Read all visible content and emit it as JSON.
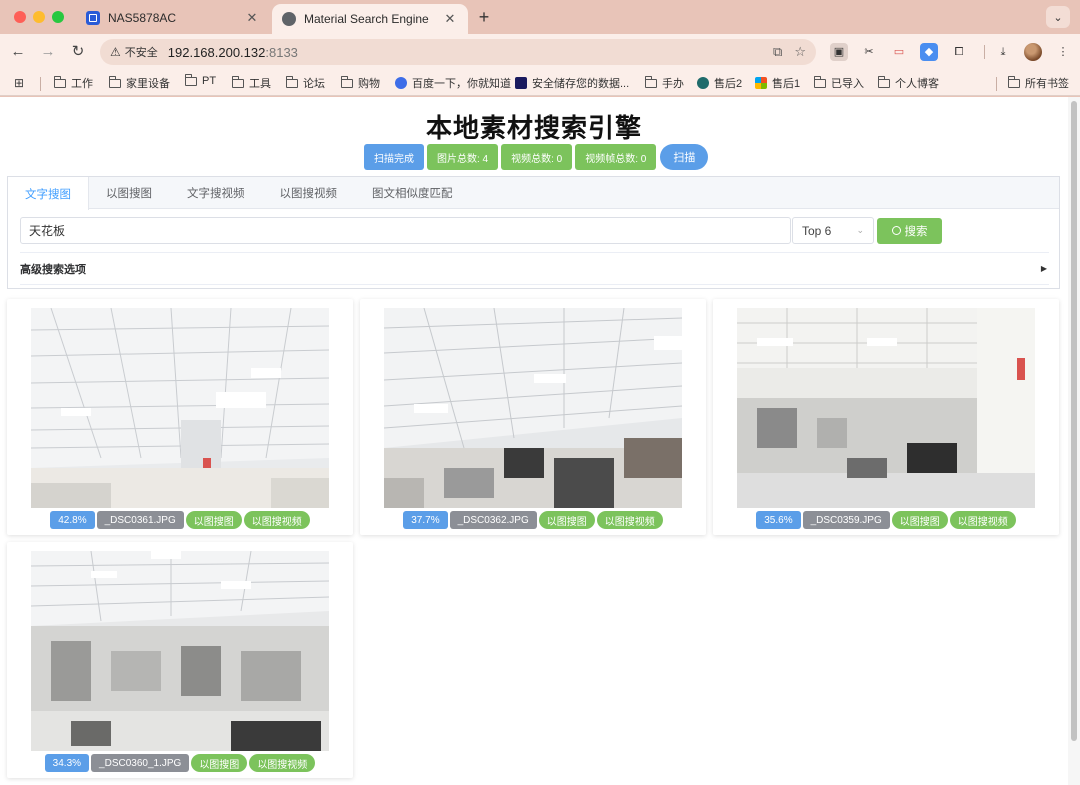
{
  "browser": {
    "tabs": [
      {
        "title": "NAS5878AC",
        "active": false
      },
      {
        "title": "Material Search Engine",
        "active": true
      }
    ],
    "insecure_label": "不安全",
    "url_host": "192.168.200.132",
    "url_port": ":8133",
    "bookmarks": [
      "工作",
      "家里设备",
      "PT",
      "工具",
      "论坛",
      "购物",
      "百度一下，你就知道",
      "安全储存您的数据...",
      "手办",
      "售后2",
      "售后1",
      "已导入",
      "个人博客"
    ],
    "all_bookmarks": "所有书签"
  },
  "page": {
    "title": "本地素材搜索引擎",
    "stats": {
      "scan_status": "扫描完成",
      "image_count": "图片总数: 4",
      "video_count": "视频总数: 0",
      "frame_count": "视频帧总数: 0"
    },
    "scan_button": "扫描",
    "tabs": [
      "文字搜图",
      "以图搜图",
      "文字搜视频",
      "以图搜视频",
      "图文相似度匹配"
    ],
    "active_tab": "文字搜图",
    "search": {
      "value": "天花板",
      "topk": "Top 6",
      "button": "搜索"
    },
    "advanced_label": "高级搜索选项",
    "action_image": "以图搜图",
    "action_video": "以图搜视频",
    "results": [
      {
        "score": "42.8%",
        "filename": "_DSC0361.JPG"
      },
      {
        "score": "37.7%",
        "filename": "_DSC0362.JPG"
      },
      {
        "score": "35.6%",
        "filename": "_DSC0359.JPG"
      },
      {
        "score": "34.3%",
        "filename": "_DSC0360_1.JPG"
      }
    ]
  },
  "colors": {
    "primary_blue": "#5b9ee8",
    "success_green": "#7cc35c",
    "info_gray": "#8c8f96",
    "chrome_bg": "#e8c4b8"
  }
}
